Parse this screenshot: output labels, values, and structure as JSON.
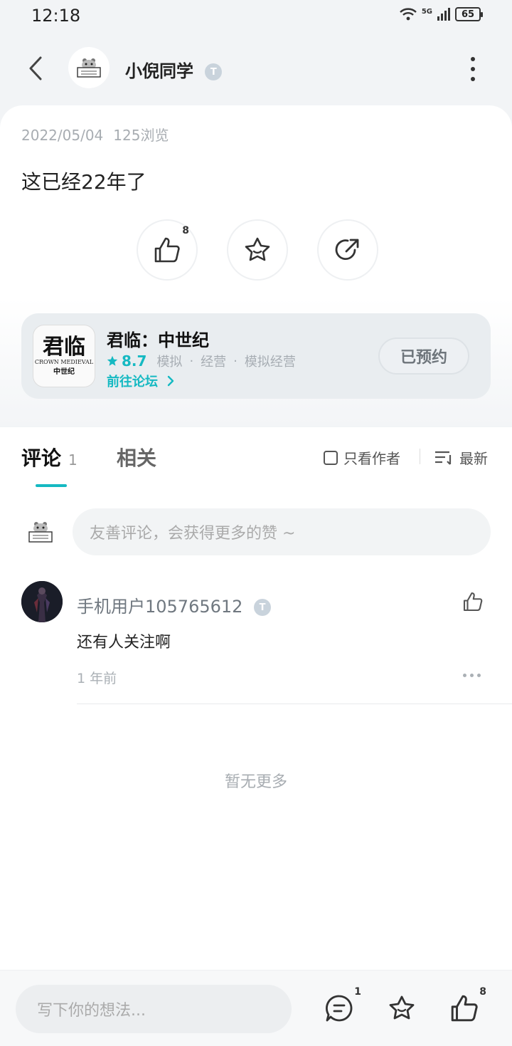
{
  "status_bar": {
    "time": "12:18",
    "network": "5G",
    "battery": "65"
  },
  "header": {
    "author_name": "小倪同学",
    "level_badge": "T"
  },
  "post": {
    "date": "2022/05/04",
    "views": "125浏览",
    "text": "这已经22年了",
    "like_count": "8"
  },
  "game": {
    "name": "君临：中世纪",
    "logo_text": "君临",
    "logo_sub": "CROWN MEDIEVAL",
    "logo_cn": "中世纪",
    "rating": "8.7",
    "tags": [
      "模拟",
      "经营",
      "模拟经营"
    ],
    "forum_link": "前往论坛",
    "reserve_label": "已预约"
  },
  "tabs": {
    "comments_label": "评论",
    "comments_count": "1",
    "related_label": "相关",
    "author_only_label": "只看作者",
    "sort_label": "最新"
  },
  "comment_input": {
    "placeholder": "友善评论，会获得更多的赞 ~"
  },
  "comments": [
    {
      "user": "手机用户105765612",
      "text": "还有人关注啊",
      "time": "1 年前"
    }
  ],
  "no_more": "暂无更多",
  "bottom_bar": {
    "placeholder": "写下你的想法...",
    "comment_count": "1",
    "like_count": "8"
  },
  "colors": {
    "accent": "#15b9c2",
    "background": "#f2f4f6"
  }
}
